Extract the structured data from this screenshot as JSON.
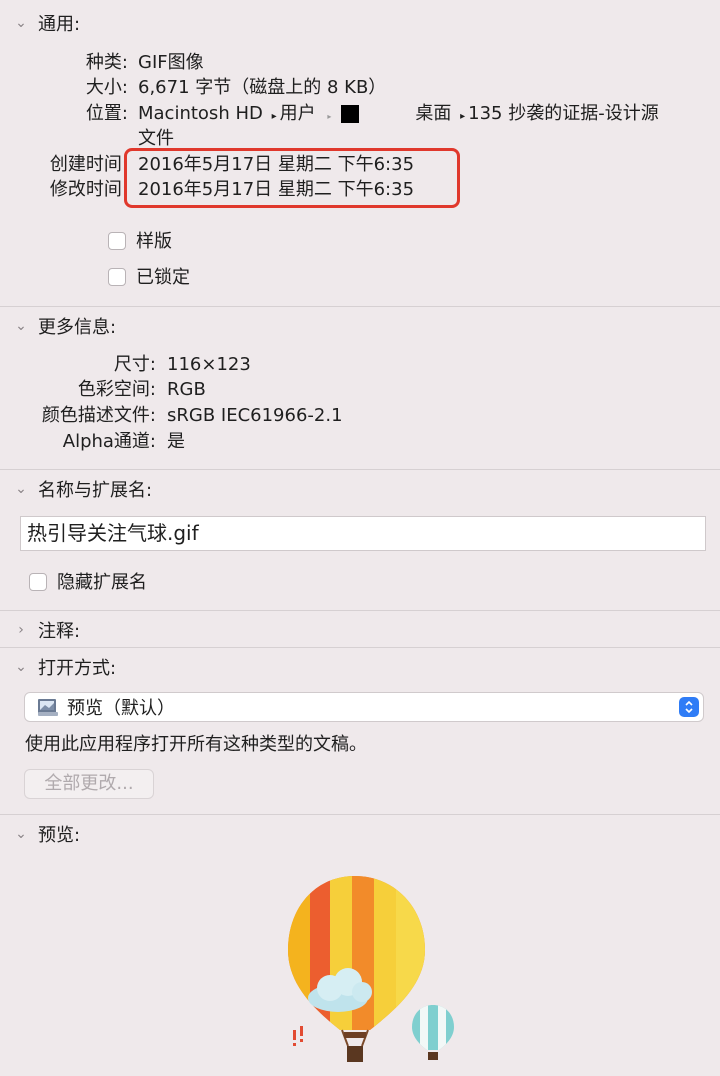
{
  "general": {
    "header": "通用:",
    "kind_label": "种类:",
    "kind_value": "GIF图像",
    "size_label": "大小:",
    "size_value": "6,671 字节（磁盘上的 8 KB）",
    "where_label": "位置:",
    "where_part1": "Macintosh HD",
    "where_part2": "用户",
    "where_part3": "桌面",
    "where_part4": "135 抄袭的证据-设计源",
    "where_wrap": "文件",
    "created_label": "创建时间:",
    "created_value": "2016年5月17日 星期二 下午6:35",
    "modified_label": "修改时间:",
    "modified_value": "2016年5月17日 星期二 下午6:35",
    "stationery_label": "样版",
    "locked_label": "已锁定"
  },
  "more_info": {
    "header": "更多信息:",
    "dimensions_label": "尺寸:",
    "dimensions_value": "116×123",
    "colorspace_label": "色彩空间:",
    "colorspace_value": "RGB",
    "profile_label": "颜色描述文件:",
    "profile_value": "sRGB IEC61966-2.1",
    "alpha_label": "Alpha通道:",
    "alpha_value": "是"
  },
  "name_ext": {
    "header": "名称与扩展名:",
    "filename": "热引导关注气球.gif",
    "hide_ext_label": "隐藏扩展名"
  },
  "comments": {
    "header": "注释:"
  },
  "open_with": {
    "header": "打开方式:",
    "app_name": "预览（默认）",
    "description": "使用此应用程序打开所有这种类型的文稿。",
    "change_all_button": "全部更改..."
  },
  "preview": {
    "header": "预览:"
  },
  "colors": {
    "background": "#efe9eb",
    "highlight_border": "#e0382c",
    "accent": "#2f7cf6"
  },
  "icons": {
    "disclosure_open": "chevron-down-icon",
    "disclosure_closed": "chevron-right-icon",
    "path_separator": "triangle-right-icon",
    "app": "preview-app-icon",
    "stepper": "up-down-stepper-icon"
  }
}
